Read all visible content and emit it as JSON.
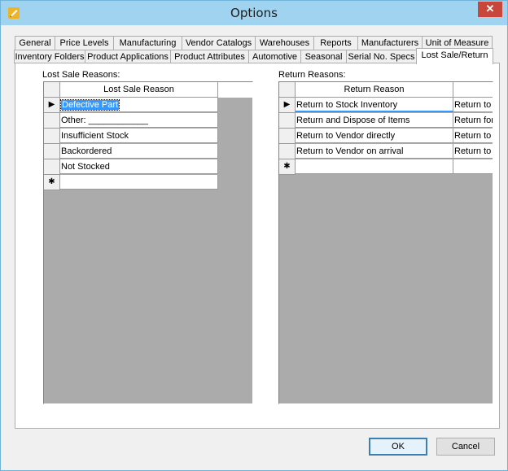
{
  "window": {
    "title": "Options",
    "close_label": "✕"
  },
  "tabs_top": [
    "General",
    "Price Levels",
    "Manufacturing",
    "Vendor Catalogs",
    "Warehouses",
    "Reports",
    "Manufacturers",
    "Unit of Measure"
  ],
  "tabs_bottom": [
    "Inventory Folders",
    "Product Applications",
    "Product Attributes",
    "Automotive",
    "Seasonal",
    "Serial No. Specs",
    "Lost Sale/Return"
  ],
  "active_tab": "Lost Sale/Return",
  "lost_sale": {
    "label": "Lost Sale Reasons:",
    "column": "Lost Sale Reason",
    "rows": [
      "Defective Part",
      "Other: ____________",
      "Insufficient Stock",
      "Backordered",
      "Not Stocked"
    ],
    "current_row_marker": "▶",
    "new_row_marker": "✱"
  },
  "return": {
    "label": "Return Reasons:",
    "column": "Return Reason",
    "rows": [
      [
        "Return to Stock Inventory",
        "Return to"
      ],
      [
        "Return and Dispose of Items",
        "Return for"
      ],
      [
        "Return to Vendor directly",
        "Return to"
      ],
      [
        "Return to Vendor on arrival",
        "Return to"
      ]
    ],
    "current_row_marker": "▶",
    "new_row_marker": "✱"
  },
  "buttons": {
    "ok": "OK",
    "cancel": "Cancel"
  }
}
